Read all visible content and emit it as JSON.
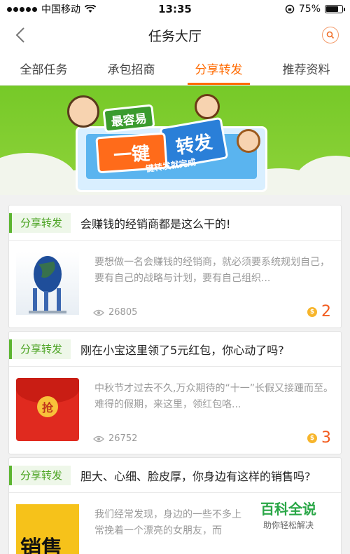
{
  "status_bar": {
    "carrier": "中国移动",
    "time": "13:35",
    "battery": "75%",
    "battery_level": 0.75
  },
  "nav": {
    "title": "任务大厅"
  },
  "tabs": [
    {
      "label": "全部任务",
      "active": false
    },
    {
      "label": "承包招商",
      "active": false
    },
    {
      "label": "分享转发",
      "active": true
    },
    {
      "label": "推荐资料",
      "active": false
    }
  ],
  "banner": {
    "badge_top": "最容易",
    "word_left": "一键",
    "word_right": "转发",
    "subtitle": "一键转发就完成"
  },
  "cards": [
    {
      "tag": "分享转发",
      "title": "会赚钱的经销商都是这么干的!",
      "description": "要想做一名会赚钱的经销商，就必须要系统规划自己，要有自己的战略与计划，要有自己组织...",
      "views": "26805",
      "reward": "2",
      "thumb_icon": "globe-pillars-thumbnail"
    },
    {
      "tag": "分享转发",
      "title": "刚在小宝这里领了5元红包，你心动了吗?",
      "description": "中秋节才过去不久,万众期待的“十一”长假又接踵而至。难得的假期，来这里，领红包咯...",
      "views": "26752",
      "reward": "3",
      "thumb_icon": "red-envelope-thumbnail",
      "thumb_text": "抢"
    },
    {
      "tag": "分享转发",
      "title": "胆大、心细、脸皮厚，你身边有这样的销售吗?",
      "description": "我们经常发现，身边的一些不多上常挽着一个漂亮的女朋友，而",
      "thumb_icon": "sales-thumbnail",
      "thumb_text": "销售"
    }
  ],
  "watermark": {
    "title": "百科全说",
    "subtitle": "助你轻松解决"
  },
  "colors": {
    "accent": "#ff6a00",
    "tag_green": "#4aa321",
    "reward": "#f25b1e"
  }
}
